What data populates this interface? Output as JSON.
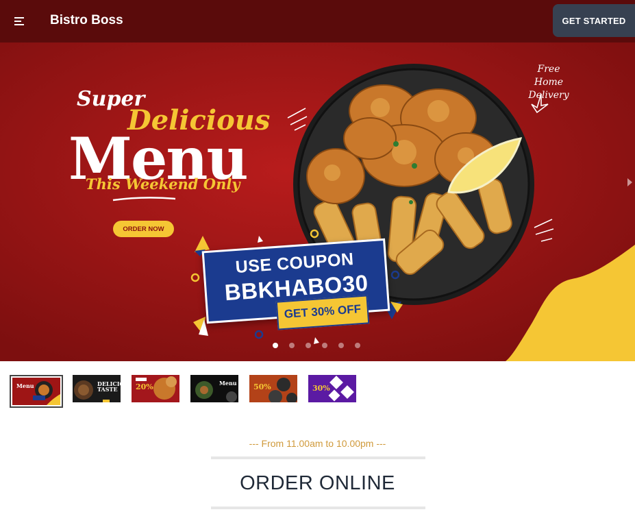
{
  "navbar": {
    "brand": "Bistro Boss",
    "cta_label": "GET STARTED",
    "menu_icon": "hamburger-menu-icon",
    "background": "#5a0b0b"
  },
  "hero": {
    "line_super": "Super",
    "line_delicious": "Delicious",
    "line_menu": "Menu",
    "line_weekend": "This Weekend Only",
    "order_button": "ORDER NOW",
    "free_delivery_1": "Free Home",
    "free_delivery_2": "Delivery",
    "coupon_line1": "USE COUPON",
    "coupon_code": "BBKHABO30",
    "discount": "GET 30% OFF",
    "next_icon": "chevron-right-icon",
    "active_slide": 1,
    "slide_count": 6,
    "colors": {
      "red": "#9e1515",
      "yellow": "#f5c634",
      "blue": "#1b3b8f"
    }
  },
  "thumbnails": [
    {
      "name": "menu-slide",
      "text": "Menu"
    },
    {
      "name": "delicious-taste-slide",
      "text": "DELICIOUS TASTE"
    },
    {
      "name": "discount-20-slide",
      "text": "20%"
    },
    {
      "name": "menu-dark-slide",
      "text": "Menu"
    },
    {
      "name": "discount-50-slide",
      "text": "50%"
    },
    {
      "name": "discount-30-slide",
      "text": "30%"
    }
  ],
  "section": {
    "hours": "--- From 11.00am to 10.00pm ---",
    "title": "ORDER ONLINE",
    "accent": "#d09a3b"
  }
}
